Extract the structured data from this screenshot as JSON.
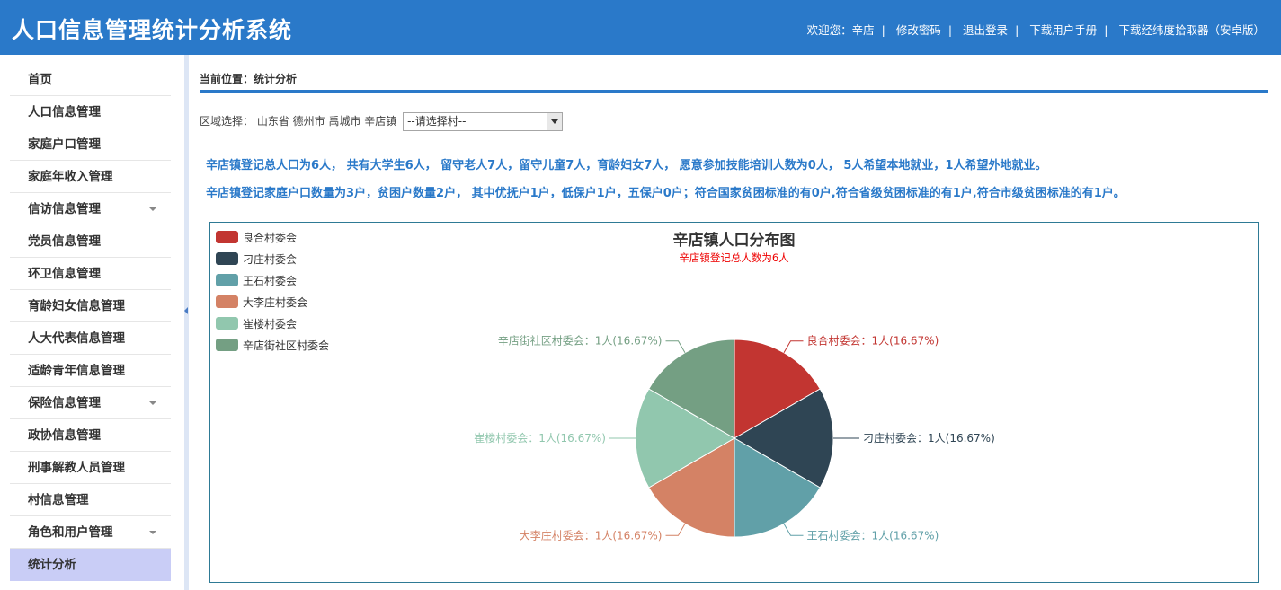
{
  "app": {
    "title": "人口信息管理统计分析系统",
    "links": [
      "欢迎您：辛店",
      "修改密码",
      "退出登录",
      "下载用户手册",
      "下载经纬度拾取器（安卓版）"
    ]
  },
  "sidebar": {
    "items": [
      {
        "label": "首页"
      },
      {
        "label": "人口信息管理"
      },
      {
        "label": "家庭户口管理"
      },
      {
        "label": "家庭年收入管理"
      },
      {
        "label": "信访信息管理",
        "expandable": true
      },
      {
        "label": "党员信息管理"
      },
      {
        "label": "环卫信息管理"
      },
      {
        "label": "育龄妇女信息管理"
      },
      {
        "label": "人大代表信息管理"
      },
      {
        "label": "适龄青年信息管理"
      },
      {
        "label": "保险信息管理",
        "expandable": true
      },
      {
        "label": "政协信息管理"
      },
      {
        "label": "刑事解教人员管理"
      },
      {
        "label": "村信息管理"
      },
      {
        "label": "角色和用户管理",
        "expandable": true
      },
      {
        "label": "统计分析",
        "active": true
      }
    ]
  },
  "main": {
    "breadcrumb": "当前位置：统计分析",
    "region_label": "区域选择： 山东省 德州市 禹城市 辛店镇",
    "region_select": "--请选择村--",
    "stats_line1": "辛店镇登记总人口为6人， 共有大学生6人， 留守老人7人，留守儿童7人，育龄妇女7人， 愿意参加技能培训人数为0人， 5人希望本地就业，1人希望外地就业。",
    "stats_line2": "辛店镇登记家庭户口数量为3户，贫困户数量2户， 其中优抚户1户，低保户1户，五保户0户；符合国家贫困标准的有0户,符合省级贫困标准的有1户,符合市级贫困标准的有1户。"
  },
  "chart_data": {
    "type": "pie",
    "title": "辛店镇人口分布图",
    "subtitle": "辛店镇登记总人数为6人",
    "legend_position": "top-left",
    "slices": [
      {
        "name": "良合村委会",
        "value": 1,
        "percent": "16.67%",
        "color": "#c23531",
        "label": "良合村委会：1人(16.67%)"
      },
      {
        "name": "刁庄村委会",
        "value": 1,
        "percent": "16.67%",
        "color": "#2f4554",
        "label": "刁庄村委会：1人(16.67%)"
      },
      {
        "name": "王石村委会",
        "value": 1,
        "percent": "16.67%",
        "color": "#61a0a8",
        "label": "王石村委会：1人(16.67%)"
      },
      {
        "name": "大李庄村委会",
        "value": 1,
        "percent": "16.67%",
        "color": "#d48265",
        "label": "大李庄村委会：1人(16.67%)"
      },
      {
        "name": "崔楼村委会",
        "value": 1,
        "percent": "16.67%",
        "color": "#91c7ae",
        "label": "崔楼村委会：1人(16.67%)"
      },
      {
        "name": "辛店街社区村委会",
        "value": 1,
        "percent": "16.67%",
        "color": "#749f83",
        "label": "辛店街社区村委会：1人(16.67%)"
      }
    ]
  }
}
